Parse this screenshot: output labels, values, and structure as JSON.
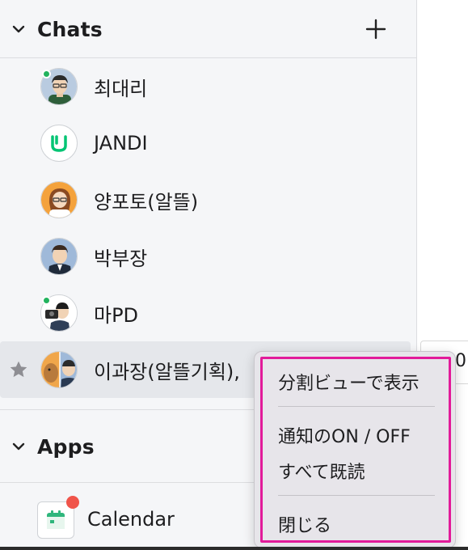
{
  "sidebar": {
    "chats": {
      "title": "Chats",
      "add_label": "+",
      "items": [
        {
          "name": "최대리",
          "avatar": "man-glasses-green-shirt",
          "online": true,
          "starred": false
        },
        {
          "name": "JANDI",
          "avatar": "jandi-logo",
          "online": false,
          "starred": false
        },
        {
          "name": "양포토(알뜰)",
          "avatar": "woman-glasses-orange-bg",
          "online": false,
          "starred": false
        },
        {
          "name": "박부장",
          "avatar": "man-suit-blue-bg",
          "online": false,
          "starred": false
        },
        {
          "name": "마PD",
          "avatar": "man-camera",
          "online": true,
          "starred": false
        },
        {
          "name": "이과장(알뜰기획),",
          "avatar": "group-dog-man",
          "online": false,
          "starred": true
        }
      ]
    },
    "apps": {
      "title": "Apps",
      "items": [
        {
          "name": "Calendar",
          "icon": "calendar-icon",
          "has_notification": true
        }
      ]
    }
  },
  "right_panel": {
    "chip_text": "0"
  },
  "context_menu": {
    "items": [
      {
        "label": "分割ビューで表示"
      },
      {
        "label": "通知のON / OFF"
      },
      {
        "label": "すべて既読"
      },
      {
        "label": "閉じる"
      }
    ]
  },
  "colors": {
    "online": "#22b35e",
    "notification": "#f0544a",
    "highlight_border": "#e21b9a",
    "jandi_green": "#00c473",
    "calendar_green": "#2fb67c"
  }
}
